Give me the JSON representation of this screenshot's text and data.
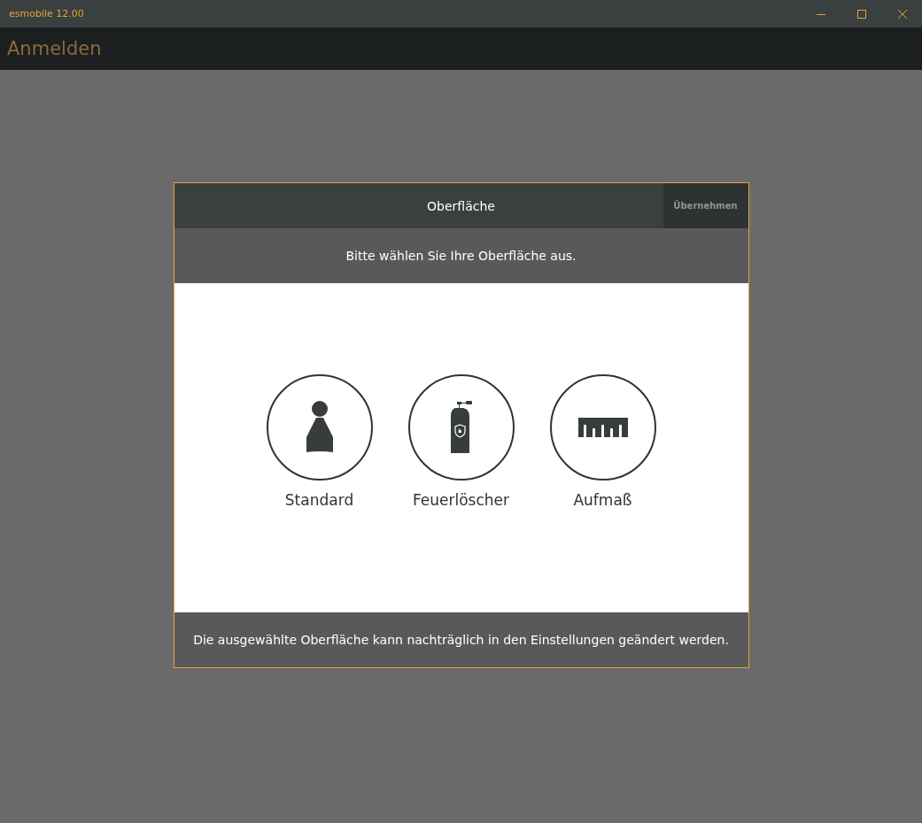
{
  "window": {
    "title": "esmobile 12.00"
  },
  "header": {
    "title": "Anmelden"
  },
  "dialog": {
    "title": "Oberfläche",
    "apply_button": {
      "label": "Übernehmen",
      "disabled": true
    },
    "prompt": "Bitte wählen Sie Ihre Oberfläche aus.",
    "options": [
      {
        "kind": "person",
        "label": "Standard"
      },
      {
        "kind": "extinguisher",
        "label": "Feuerlöscher"
      },
      {
        "kind": "ruler",
        "label": "Aufmaß"
      }
    ],
    "footer": "Die ausgewählte Oberfläche kann nachträglich in den Einstellungen geändert werden."
  }
}
